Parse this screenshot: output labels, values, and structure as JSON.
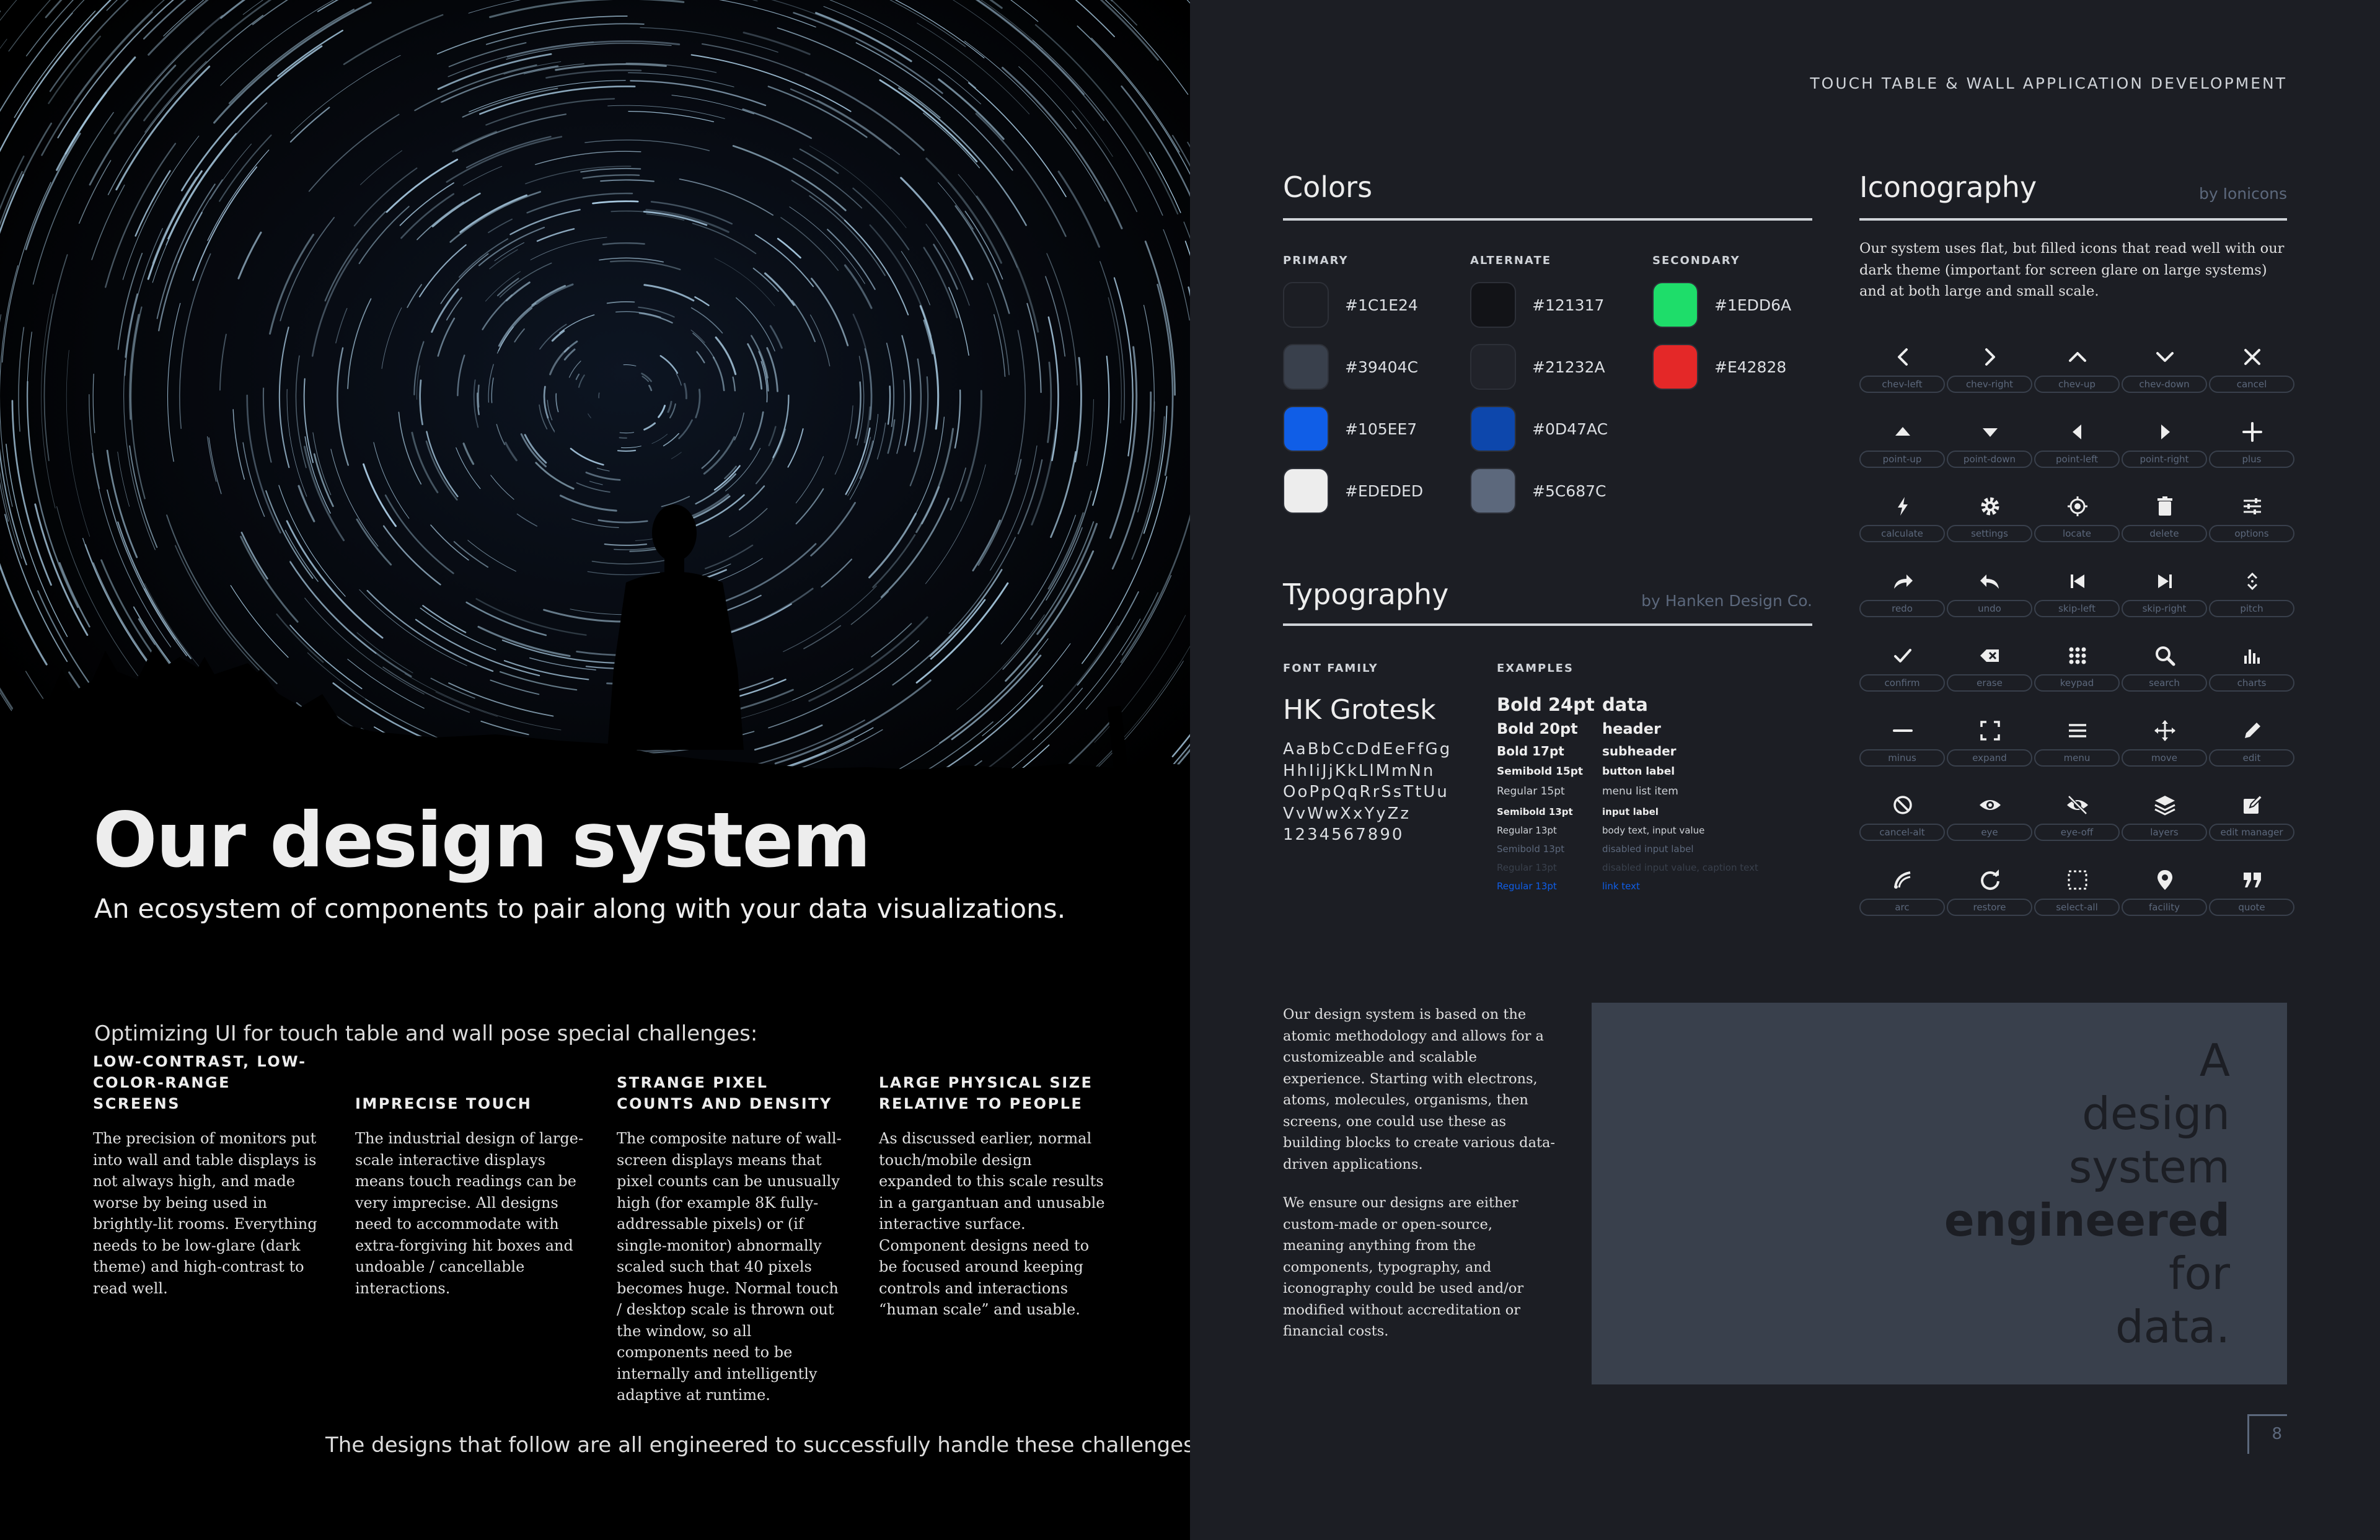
{
  "left": {
    "title": "Our design system",
    "subtitle": "An ecosystem of components to pair along with your data visualizations.",
    "intro": "Optimizing UI for touch table and wall pose special challenges:",
    "challenges": [
      {
        "title": "LOW-CONTRAST, LOW-COLOR-RANGE SCREENS",
        "body": "The precision of monitors put into wall and table displays is not always high, and made worse by being used in brightly-lit rooms. Everything needs to be low-glare (dark theme) and high-contrast to read well."
      },
      {
        "title": "IMPRECISE TOUCH",
        "body": "The industrial design of large-scale interactive displays means touch readings can be very imprecise. All designs need to accommodate with extra-forgiving hit boxes and undoable / cancellable interactions."
      },
      {
        "title": "STRANGE PIXEL COUNTS AND DENSITY",
        "body": "The composite nature of wall-screen displays means that pixel counts can be unusually high (for example 8K fully-addressable pixels) or (if single-monitor) abnormally scaled such that 40 pixels becomes huge. Normal touch / desktop scale is thrown out the window, so all components need to be internally and intelligently adaptive at runtime."
      },
      {
        "title": "LARGE PHYSICAL SIZE RELATIVE TO PEOPLE",
        "body": "As discussed earlier, normal touch/mobile design expanded to this scale results in a gargantuan and unusable interactive surface. Component designs need to be focused around keeping controls and interactions “human scale” and usable."
      }
    ],
    "outro": "The designs that follow are all engineered to successfully handle these challenges."
  },
  "right": {
    "header": "TOUCH TABLE & WALL APPLICATION DEVELOPMENT",
    "colors": {
      "title": "Colors",
      "groups": [
        {
          "label": "PRIMARY",
          "swatches": [
            "#1C1E24",
            "#39404C",
            "#105EE7",
            "#EDEDED"
          ]
        },
        {
          "label": "ALTERNATE",
          "swatches": [
            "#121317",
            "#21232A",
            "#0D47AC",
            "#5C687C"
          ]
        },
        {
          "label": "SECONDARY",
          "swatches": [
            "#1EDD6A",
            "#E42828"
          ]
        }
      ]
    },
    "typography": {
      "title": "Typography",
      "credit": "by Hanken Design Co.",
      "family_label": "FONT FAMILY",
      "family_name": "HK Grotesk",
      "alphabet": "AaBbCcDdEeFfGg\nHhIiJjKkLlMmNn\nOoPpQqRrSsTtUu\nVvWwXxYyZz\n1234567890",
      "examples_label": "EXAMPLES",
      "examples": [
        {
          "style": "Bold 24pt",
          "name": "data"
        },
        {
          "style": "Bold 20pt",
          "name": "header"
        },
        {
          "style": "Bold 17pt",
          "name": "subheader"
        },
        {
          "style": "Semibold 15pt",
          "name": "button label"
        },
        {
          "style": "Regular 15pt",
          "name": "menu list item"
        },
        {
          "style": "Semibold 13pt",
          "name": "input label"
        },
        {
          "style": "Regular 13pt",
          "name": "body text, input value"
        },
        {
          "style": "Semibold 13pt",
          "name": "disabled input label"
        },
        {
          "style": "Regular 13pt",
          "name": "disabled input value, caption text"
        },
        {
          "style": "Regular 13pt",
          "name": "link text"
        }
      ]
    },
    "iconography": {
      "title": "Iconography",
      "credit": "by Ionicons",
      "intro": "Our system uses flat, but filled icons that read well with our dark theme (important for screen glare on large systems) and at both large and small scale.",
      "icons": [
        {
          "icon": "chevron-left-icon",
          "label": "chev-left"
        },
        {
          "icon": "chevron-right-icon",
          "label": "chev-right"
        },
        {
          "icon": "chevron-up-icon",
          "label": "chev-up"
        },
        {
          "icon": "chevron-down-icon",
          "label": "chev-down"
        },
        {
          "icon": "cancel-icon",
          "label": "cancel"
        },
        {
          "icon": "point-up-icon",
          "label": "point-up"
        },
        {
          "icon": "point-down-icon",
          "label": "point-down"
        },
        {
          "icon": "point-left-icon",
          "label": "point-left"
        },
        {
          "icon": "point-right-icon",
          "label": "point-right"
        },
        {
          "icon": "plus-icon",
          "label": "plus"
        },
        {
          "icon": "calculate-icon",
          "label": "calculate"
        },
        {
          "icon": "settings-icon",
          "label": "settings"
        },
        {
          "icon": "locate-icon",
          "label": "locate"
        },
        {
          "icon": "delete-icon",
          "label": "delete"
        },
        {
          "icon": "options-icon",
          "label": "options"
        },
        {
          "icon": "redo-icon",
          "label": "redo"
        },
        {
          "icon": "undo-icon",
          "label": "undo"
        },
        {
          "icon": "skip-left-icon",
          "label": "skip-left"
        },
        {
          "icon": "skip-right-icon",
          "label": "skip-right"
        },
        {
          "icon": "pitch-icon",
          "label": "pitch"
        },
        {
          "icon": "confirm-icon",
          "label": "confirm"
        },
        {
          "icon": "erase-icon",
          "label": "erase"
        },
        {
          "icon": "keypad-icon",
          "label": "keypad"
        },
        {
          "icon": "search-icon",
          "label": "search"
        },
        {
          "icon": "charts-icon",
          "label": "charts"
        },
        {
          "icon": "minus-icon",
          "label": "minus"
        },
        {
          "icon": "expand-icon",
          "label": "expand"
        },
        {
          "icon": "menu-icon",
          "label": "menu"
        },
        {
          "icon": "move-icon",
          "label": "move"
        },
        {
          "icon": "edit-icon",
          "label": "edit"
        },
        {
          "icon": "cancel-alt-icon",
          "label": "cancel-alt"
        },
        {
          "icon": "eye-icon",
          "label": "eye"
        },
        {
          "icon": "eye-off-icon",
          "label": "eye-off"
        },
        {
          "icon": "layers-icon",
          "label": "layers"
        },
        {
          "icon": "edit-manager-icon",
          "label": "edit manager"
        },
        {
          "icon": "arc-icon",
          "label": "arc"
        },
        {
          "icon": "restore-icon",
          "label": "restore"
        },
        {
          "icon": "select-all-icon",
          "label": "select-all"
        },
        {
          "icon": "facility-icon",
          "label": "facility"
        },
        {
          "icon": "quote-icon",
          "label": "quote"
        }
      ]
    },
    "body": [
      "Our design system is based on the atomic methodology and allows for a customizeable and scalable experience. Starting with electrons, atoms, molecules, organisms, then screens, one could use these as building blocks to create various data-driven applications.",
      "We ensure our designs are either custom-made or open-source, meaning anything from the components, typography, and iconography could be used and/or modified without accreditation or financial costs."
    ],
    "quote_lines": [
      "A",
      "design",
      "system",
      "engineered",
      "for",
      "data."
    ],
    "page_number": "8"
  }
}
